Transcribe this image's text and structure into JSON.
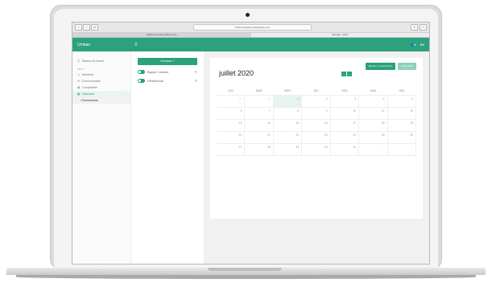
{
  "browser": {
    "address": "Il.demonstration.prestashop.com",
    "tabs": [
      "Solution Commerce CMS de Luxe",
      "Calendrier - Admin"
    ]
  },
  "app": {
    "brand": "Umbao",
    "header_icons": [
      "user-icon",
      "settings-icon"
    ]
  },
  "sidebar": {
    "top_item": "Tableau de Board",
    "section": "MENU",
    "items": [
      {
        "label": "Membres",
        "active": false
      },
      {
        "label": "Communication",
        "active": false
      },
      {
        "label": "Comptabilité",
        "active": false
      },
      {
        "label": "Calendrier",
        "active": true
      }
    ],
    "sub_item": "Événements"
  },
  "filters": {
    "new_button": "Nouveau +",
    "toggles": [
      {
        "label": "Équipe 1 séniors"
      },
      {
        "label": "Général club"
      }
    ]
  },
  "calendar": {
    "title": "juillet 2020",
    "add_button": "Ajouter un événement",
    "today_button": "Aujourd'hui",
    "days": [
      "LUN.",
      "MAR.",
      "MER.",
      "JEU.",
      "VEN.",
      "SAM.",
      "DIM."
    ],
    "weeks": [
      [
        {
          "d": "29",
          "m": true
        },
        {
          "d": "30",
          "m": true
        },
        {
          "d": "1",
          "t": true
        },
        {
          "d": "2"
        },
        {
          "d": "3"
        },
        {
          "d": "4"
        },
        {
          "d": "5"
        }
      ],
      [
        {
          "d": "6"
        },
        {
          "d": "7"
        },
        {
          "d": "8"
        },
        {
          "d": "9"
        },
        {
          "d": "10"
        },
        {
          "d": "11"
        },
        {
          "d": "12"
        }
      ],
      [
        {
          "d": "13"
        },
        {
          "d": "14"
        },
        {
          "d": "15"
        },
        {
          "d": "16"
        },
        {
          "d": "17"
        },
        {
          "d": "18"
        },
        {
          "d": "19"
        }
      ],
      [
        {
          "d": "20"
        },
        {
          "d": "21"
        },
        {
          "d": "22"
        },
        {
          "d": "23"
        },
        {
          "d": "24"
        },
        {
          "d": "25"
        },
        {
          "d": "26"
        }
      ],
      [
        {
          "d": "27"
        },
        {
          "d": "28"
        },
        {
          "d": "29"
        },
        {
          "d": "30"
        },
        {
          "d": "31"
        },
        {
          "d": "1",
          "m": true
        },
        {
          "d": "2",
          "m": true
        }
      ]
    ]
  },
  "colors": {
    "accent": "#2ba17c",
    "accent_light": "#8fd1b8"
  }
}
